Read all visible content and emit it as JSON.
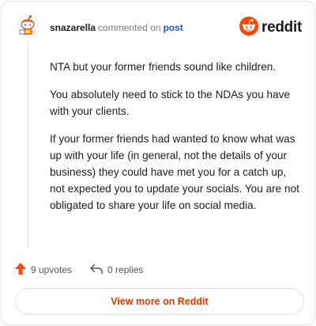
{
  "header": {
    "username": "snazarella",
    "commented_text": "commented on",
    "post_link": "post",
    "brand": "reddit"
  },
  "comment": {
    "paragraphs": [
      "NTA but your former friends sound like children.",
      "You absolutely need to stick to the NDAs you have with your clients.",
      "If your former friends had wanted to know what was up with your life (in general, not the details of your business) they could have met you for a catch up, not expected you to update your socials. You are not obligated to share your life on social media."
    ]
  },
  "actions": {
    "upvotes": "9 upvotes",
    "replies": "0 replies"
  },
  "view_more": "View more on Reddit",
  "colors": {
    "accent": "#ff4500",
    "link": "#1f5ad3",
    "view_more_text": "#d93a00"
  },
  "icons": {
    "avatar": "snoo-avatar-icon",
    "brand": "reddit-logo-icon",
    "upvote": "upvote-arrow-icon",
    "reply": "reply-arrow-icon"
  }
}
